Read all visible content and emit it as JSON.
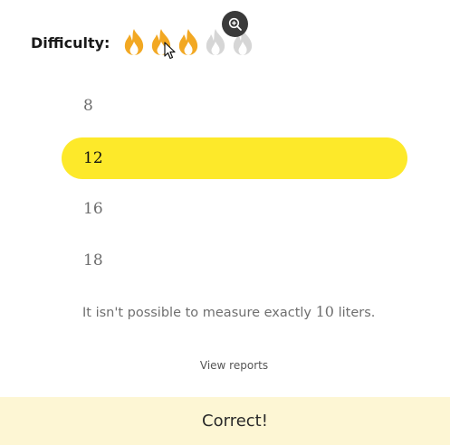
{
  "difficulty": {
    "label": "Difficulty:",
    "rating": 3,
    "max": 5,
    "active_color": "#f2a823",
    "inactive_color": "#d6d6d6",
    "icon": "flame-icon"
  },
  "zoom_button": {
    "icon": "zoom-in-icon"
  },
  "options": [
    {
      "label": "8",
      "selected": false
    },
    {
      "label": "12",
      "selected": true
    },
    {
      "label": "16",
      "selected": false
    },
    {
      "label": "18",
      "selected": false
    }
  ],
  "explanation": {
    "text_before": "It isn't possible to measure exactly ",
    "number": "10",
    "text_after": " liters."
  },
  "view_reports_label": "View reports",
  "result": {
    "label": "Correct!",
    "background": "#fdf6d4"
  },
  "colors": {
    "selected_option": "#fde92a"
  }
}
